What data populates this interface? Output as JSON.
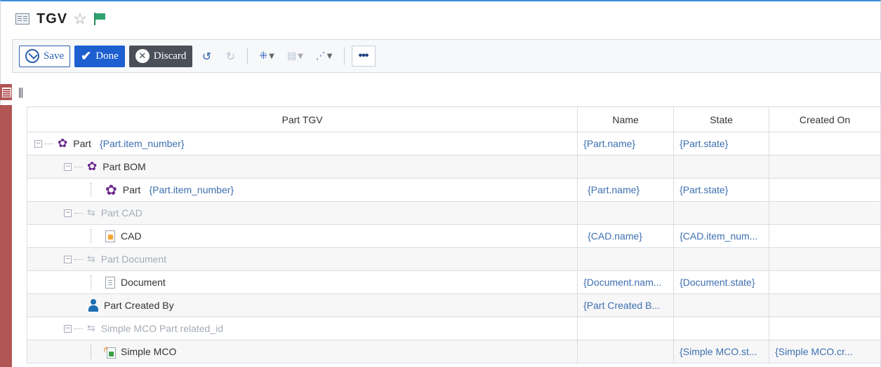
{
  "title": {
    "text": "TGV"
  },
  "toolbar": {
    "save_label": "Save",
    "done_label": "Done",
    "discard_label": "Discard"
  },
  "grid": {
    "columns": [
      "Part TGV",
      "Name",
      "State",
      "Created On"
    ],
    "rows": [
      {
        "label": "Part",
        "prop": "{Part.item_number}",
        "name": "{Part.name}",
        "state": "{Part.state}",
        "created": ""
      },
      {
        "label": "Part BOM",
        "prop": "",
        "name": "",
        "state": "",
        "created": ""
      },
      {
        "label": "Part",
        "prop": "{Part.item_number}",
        "name": "{Part.name}",
        "state": "{Part.state}",
        "created": ""
      },
      {
        "label": "Part CAD",
        "prop": "",
        "name": "",
        "state": "",
        "created": ""
      },
      {
        "label": "CAD",
        "prop": "",
        "name": "{CAD.name}",
        "state": "{CAD.item_num...",
        "created": ""
      },
      {
        "label": "Part Document",
        "prop": "",
        "name": "",
        "state": "",
        "created": ""
      },
      {
        "label": "Document",
        "prop": "",
        "name": "{Document.nam...",
        "state": "{Document.state}",
        "created": ""
      },
      {
        "label": "Part Created By",
        "prop": "",
        "name": "{Part Created B...",
        "state": "",
        "created": ""
      },
      {
        "label": "Simple MCO Part related_id",
        "prop": "",
        "name": "",
        "state": "",
        "created": ""
      },
      {
        "label": "Simple MCO",
        "prop": "",
        "name": "",
        "state": "{Simple MCO.st...",
        "created": "{Simple MCO.cr..."
      }
    ]
  }
}
